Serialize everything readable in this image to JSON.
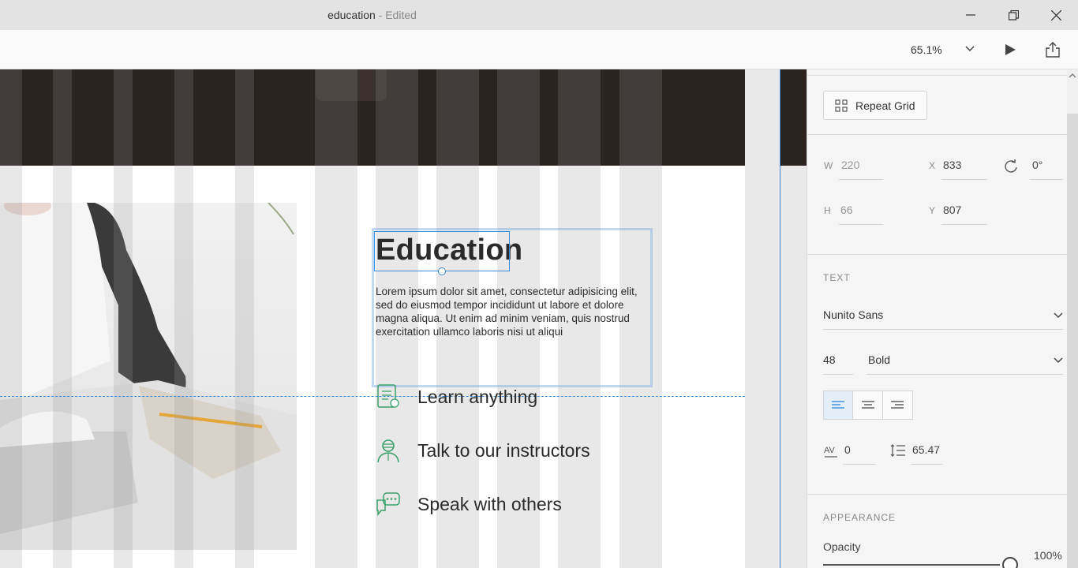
{
  "window": {
    "title": "education",
    "status": " - Edited",
    "controls": [
      "minimize",
      "restore",
      "close"
    ]
  },
  "toolbar": {
    "zoom": "65.1%",
    "play_icon": "play-icon",
    "share_icon": "share-icon"
  },
  "artboard": {
    "heading": "Education",
    "body": "Lorem ipsum dolor sit amet, consectetur adipisicing elit, sed do eiusmod tempor incididunt ut labore et dolore magna aliqua. Ut enim ad minim veniam, quis nostrud exercitation ullamco laboris nisi ut aliqui",
    "features": [
      {
        "label": "Learn anything",
        "icon": "document-icon"
      },
      {
        "label": "Talk to our instructors",
        "icon": "instructor-icon"
      },
      {
        "label": "Speak with others",
        "icon": "chat-icon"
      }
    ],
    "accent_color": "#3aa06a",
    "selection_color": "#3b8ad8"
  },
  "panel": {
    "repeat_grid": "Repeat Grid",
    "w_label": "W",
    "w_value": "220",
    "x_label": "X",
    "x_value": "833",
    "rotation": "0°",
    "h_label": "H",
    "h_value": "66",
    "y_label": "Y",
    "y_value": "807",
    "text_section": "TEXT",
    "font_family": "Nunito Sans",
    "font_size": "48",
    "font_weight": "Bold",
    "char_spacing": "0",
    "line_spacing": "65.47",
    "appearance_section": "APPEARANCE",
    "opacity_label": "Opacity",
    "opacity_value": "100%",
    "opacity_level": 1.0
  }
}
